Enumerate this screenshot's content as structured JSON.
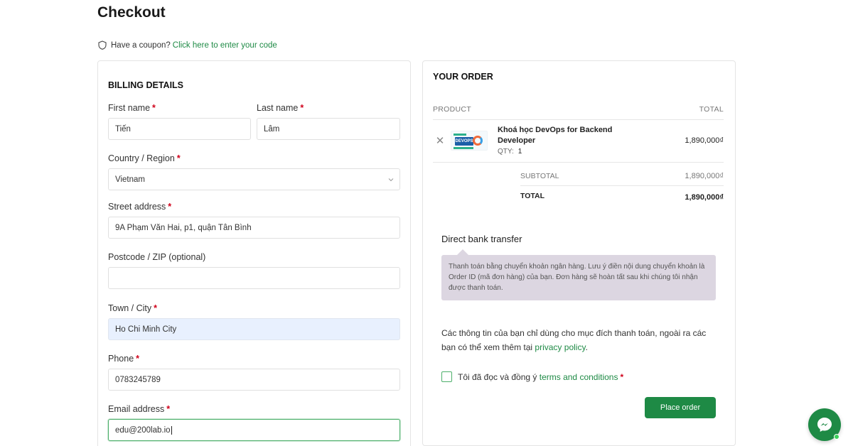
{
  "page": {
    "title": "Checkout"
  },
  "coupon": {
    "text": "Have a coupon?",
    "link": "Click here to enter your code"
  },
  "billing": {
    "title": "BILLING DETAILS",
    "first_name": {
      "label": "First name",
      "value": "Tiến"
    },
    "last_name": {
      "label": "Last name",
      "value": "Lâm"
    },
    "country": {
      "label": "Country / Region",
      "value": "Vietnam"
    },
    "street": {
      "label": "Street address",
      "value": "9A Phạm Văn Hai, p1, quận Tân Bình"
    },
    "postcode": {
      "label": "Postcode / ZIP (optional)",
      "value": ""
    },
    "city": {
      "label": "Town / City",
      "value": "Ho Chi Minh City"
    },
    "phone": {
      "label": "Phone",
      "value": "0783245789"
    },
    "email": {
      "label": "Email address",
      "value": "edu@200lab.io"
    },
    "required_mark": "*"
  },
  "order": {
    "title": "YOUR ORDER",
    "col_product": "PRODUCT",
    "col_total": "TOTAL",
    "item": {
      "name": "Khoá học DevOps for Backend Developer",
      "qty_label": "QTY:",
      "qty": "1",
      "price": "1,890,000₫",
      "thumb_badge": "DEVOPS"
    },
    "subtotal_label": "SUBTOTAL",
    "subtotal": "1,890,000₫",
    "total_label": "TOTAL",
    "total": "1,890,000₫"
  },
  "payment": {
    "method": "Direct bank transfer",
    "description": "Thanh toán bằng chuyển khoản ngân hàng. Lưu ý điền nội dung chuyển khoản là Order ID (mã đơn hàng) của bạn. Đơn hàng sẽ hoàn tất sau khi chúng tôi nhận được thanh toán."
  },
  "privacy": {
    "text": "Các thông tin của bạn chỉ dùng cho mục đích thanh toán, ngoài ra các bạn có thể xem thêm tại",
    "link": "privacy policy",
    "end": "."
  },
  "terms": {
    "text": "Tôi đã đọc và đồng ý",
    "link": "terms and conditions",
    "required_mark": "*"
  },
  "place_order": "Place order",
  "colors": {
    "accent": "#1e8a45",
    "required": "#d0021b",
    "note_bg": "#dcd6e1"
  },
  "icons": {
    "coupon": "shield-icon",
    "remove": "close-icon",
    "chat": "messenger-icon"
  }
}
